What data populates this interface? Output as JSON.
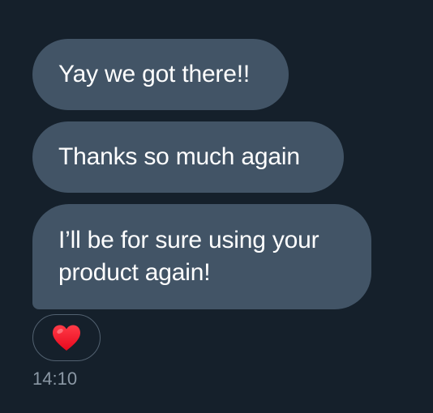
{
  "messages": [
    {
      "text": "Yay we got there!!"
    },
    {
      "text": "Thanks so much again"
    },
    {
      "text": "I’ll be for sure using your product again!"
    }
  ],
  "reaction": {
    "icon": "red-heart-icon",
    "color": "#ff1c2e"
  },
  "timestamp": "14:10",
  "colors": {
    "background": "#15202b",
    "bubble": "#425466",
    "timestamp": "#8b98a5"
  }
}
